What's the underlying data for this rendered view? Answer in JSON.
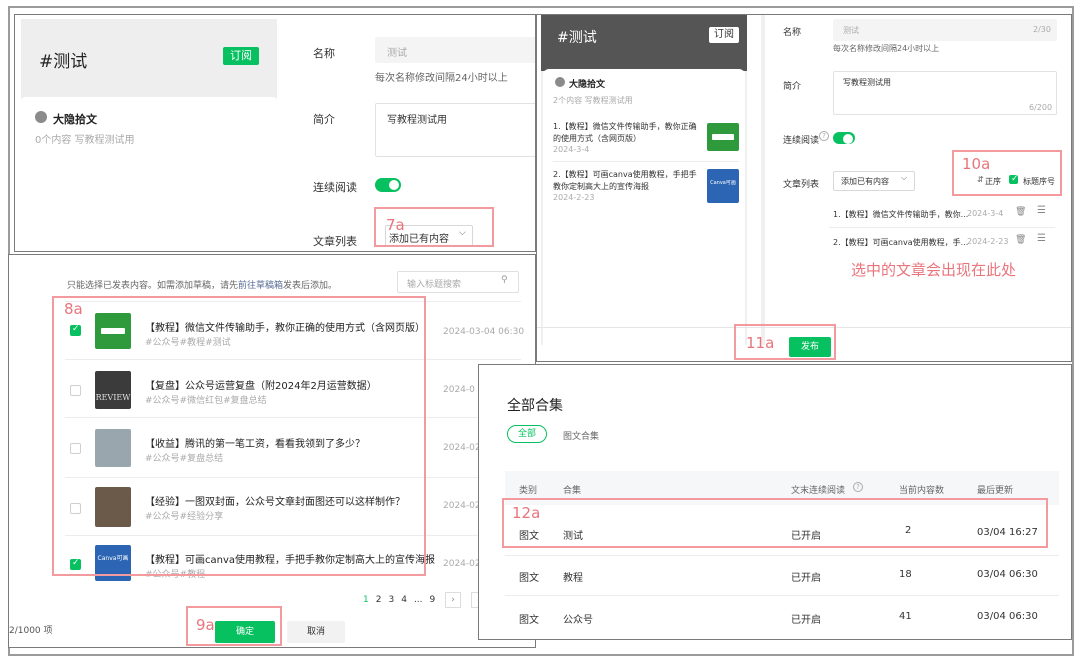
{
  "p1": {
    "title": "#测试",
    "subscribe": "订阅",
    "author": "大隐拾文",
    "meta": "0个内容  写教程测试用",
    "name_label": "名称",
    "name_value": "测试",
    "name_hint": "每次名称修改间隔24小时以上",
    "intro_label": "简介",
    "intro_value": "写教程测试用",
    "continuous_label": "连续阅读",
    "articles_label": "文章列表",
    "add_existing": "添加已有内容"
  },
  "p2": {
    "title": "#测试",
    "subscribe": "订阅",
    "author": "大隐拾文",
    "meta": "2个内容  写教程测试用",
    "preview": [
      {
        "title": "1.【教程】微信文件传输助手，教你正确的使用方式（含网页版）",
        "date": "2024-3-4"
      },
      {
        "title": "2.【教程】可画canva使用教程，手把手教你定制高大上的宣传海报",
        "date": "2024-2-23"
      }
    ],
    "thumb2_text": "Canva可画",
    "name_label": "名称",
    "name_value": "测试",
    "name_count": "2/30",
    "name_hint": "每次名称修改间隔24小时以上",
    "intro_label": "简介",
    "intro_value": "写教程测试用",
    "intro_count": "6/200",
    "continuous_label": "连续阅读",
    "articles_label": "文章列表",
    "add_existing": "添加已有内容",
    "order": "正序",
    "title_seq": "标题序号",
    "rows": [
      {
        "title": "1.【教程】微信文件传输助手，教你...",
        "date": "2024-3-4"
      },
      {
        "title": "2.【教程】可画canva使用教程，手...",
        "date": "2024-2-23"
      }
    ],
    "annotation": "选中的文章会出现在此处",
    "publish": "发布"
  },
  "p3": {
    "notice_prefix": "只能选择已发表内容。如需添加草稿，请先",
    "notice_link": "前往草稿箱",
    "notice_suffix": "发表后添加。",
    "search_placeholder": "输入标题搜索",
    "items": [
      {
        "title": "【教程】微信文件传输助手，教你正确的使用方式（含网页版）",
        "tags": "#公众号#教程#测试",
        "date": "2024-03-04 06:30"
      },
      {
        "title": "【复盘】公众号运营复盘（附2024年2月运营数据）",
        "tags": "#公众号#微信红包#复盘总结",
        "date": "2024-0"
      },
      {
        "title": "【收益】腾讯的第一笔工资，看看我领到了多少？",
        "tags": "#公众号#复盘总结",
        "date": "2024-02"
      },
      {
        "title": "【经验】一图双封面，公众号文章封面图还可以这样制作？",
        "tags": "#公众号#经验分享",
        "date": "2024-02"
      },
      {
        "title": "【教程】可画canva使用教程，手把手教你定制高大上的宣传海报",
        "tags": "#公众号#教程",
        "date": "2024-02"
      }
    ],
    "review_text": "REVIEW",
    "thumb5_text": "Canva可画",
    "pages": [
      "1",
      "2",
      "3",
      "4",
      "...",
      "9"
    ],
    "count": "2/1000 项",
    "confirm": "确定",
    "cancel": "取消"
  },
  "p4": {
    "title": "全部合集",
    "tab_all": "全部",
    "tab_image": "图文合集",
    "headers": [
      "类别",
      "合集",
      "文末连续阅读",
      "当前内容数",
      "最后更新"
    ],
    "rows": [
      {
        "type": "图文",
        "name": "测试",
        "status": "已开启",
        "count": "2",
        "updated": "03/04 16:27"
      },
      {
        "type": "图文",
        "name": "教程",
        "status": "已开启",
        "count": "18",
        "updated": "03/04 06:30"
      },
      {
        "type": "图文",
        "name": "公众号",
        "status": "已开启",
        "count": "41",
        "updated": "03/04 06:30"
      }
    ]
  },
  "labels": {
    "a7": "7a",
    "a8": "8a",
    "a9": "9a",
    "a10": "10a",
    "a11": "11a",
    "a12": "12a"
  },
  "colors": {
    "accent": "#07c160",
    "annotation": "#f29a9e",
    "annotation_text": "#e9757c"
  }
}
